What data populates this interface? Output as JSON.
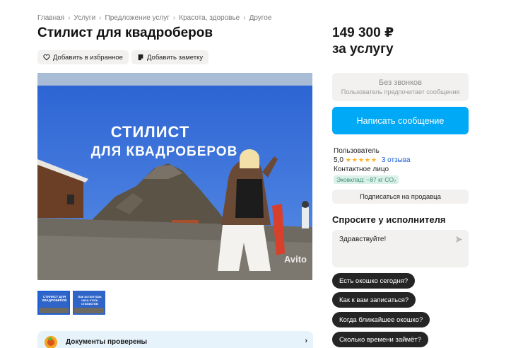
{
  "breadcrumb": [
    "Главная",
    "Услуги",
    "Предложение услуг",
    "Красота, здоровье",
    "Другое"
  ],
  "breadcrumb_sep": "›",
  "title": "Стилист для квадроберов",
  "actions": {
    "favorite_label": "Добавить в избранное",
    "note_label": "Добавить заметку"
  },
  "gallery": {
    "headline_1": "СТИЛИСТ",
    "headline_2": "ДЛЯ КВАДРОБЕРОВ",
    "watermark": "Avito",
    "thumb_text": "СТИЛИСТ ДЛЯ КВАДРОБЕРОВ",
    "thumb2_text": "Как за полтора часа стать стилистом"
  },
  "documents": {
    "label": "Документы проверены",
    "chevron": "›"
  },
  "price": {
    "amount": "149 300 ₽",
    "unit": "за услугу"
  },
  "no_calls": {
    "title": "Без звонков",
    "subtitle": "Пользователь предпочитает сообщения"
  },
  "message_button": "Написать сообщение",
  "seller": {
    "name": "Пользователь",
    "rating": "5,0",
    "stars": "★★★★★",
    "reviews": "3 отзыва",
    "contact": "Контактное лицо",
    "eco": "Эковклад: ~87 кг CO₂"
  },
  "subscribe_button": "Подписаться на продавца",
  "ask": {
    "title": "Спросите у исполнителя",
    "input_value": "Здравствуйте!",
    "questions": [
      "Есть окошко сегодня?",
      "Как к вам записаться?",
      "Когда ближайшее окошко?",
      "Сколько времени займёт?"
    ]
  },
  "colors": {
    "accent": "#00a9f5",
    "link": "#1a5fd6",
    "chip_bg": "#f2f1f0",
    "dark_chip": "#252525",
    "star": "#ffb021"
  }
}
